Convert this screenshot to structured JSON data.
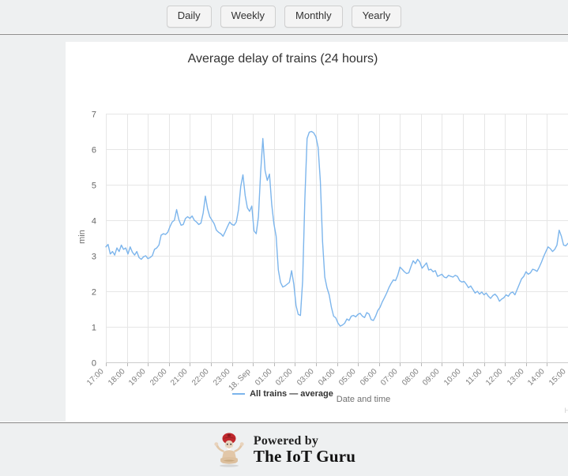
{
  "tabs": [
    {
      "label": "Daily",
      "name": "tab-daily"
    },
    {
      "label": "Weekly",
      "name": "tab-weekly"
    },
    {
      "label": "Monthly",
      "name": "tab-monthly"
    },
    {
      "label": "Yearly",
      "name": "tab-yearly"
    }
  ],
  "legend": {
    "label": "All trains — average"
  },
  "credit": "H",
  "footer": {
    "powered_by": "Powered by",
    "brand": "The IoT Guru"
  },
  "colors": {
    "series": "#7cb5ec",
    "page_background": "#eef0f1",
    "panel_background": "#ffffff",
    "grid": "#e6e6e6",
    "axis_text": "#7c7c7c",
    "title_text": "#333333"
  },
  "chart_data": {
    "type": "line",
    "title": "Average delay of trains (24 hours)",
    "xlabel": "Date and time",
    "ylabel": "min",
    "ylim": [
      0,
      7
    ],
    "yticks": [
      0,
      1,
      2,
      3,
      4,
      5,
      6,
      7
    ],
    "grid": true,
    "legend_position": "bottom",
    "xticks": [
      "17:00",
      "18:00",
      "19:00",
      "20:00",
      "21:00",
      "22:00",
      "23:00",
      "18. Sep",
      "01:00",
      "02:00",
      "03:00",
      "04:00",
      "05:00",
      "06:00",
      "07:00",
      "08:00",
      "09:00",
      "10:00",
      "11:00",
      "12:00",
      "13:00",
      "14:00",
      "15:00"
    ],
    "series": [
      {
        "name": "All trains — average",
        "unit": "min",
        "values": [
          3.25,
          3.32,
          3.05,
          3.12,
          3.02,
          3.22,
          3.12,
          3.3,
          3.18,
          3.22,
          3.05,
          3.25,
          3.1,
          3.02,
          3.12,
          2.95,
          2.9,
          2.97,
          3.0,
          2.92,
          2.95,
          3.0,
          3.18,
          3.22,
          3.3,
          3.58,
          3.62,
          3.6,
          3.66,
          3.82,
          3.95,
          4.0,
          4.3,
          4.02,
          3.86,
          3.88,
          4.05,
          4.1,
          4.05,
          4.12,
          4.0,
          3.95,
          3.88,
          3.92,
          4.2,
          4.68,
          4.32,
          4.1,
          4.0,
          3.9,
          3.72,
          3.66,
          3.62,
          3.55,
          3.68,
          3.82,
          3.95,
          3.88,
          3.86,
          3.95,
          4.3,
          4.95,
          5.28,
          4.7,
          4.35,
          4.25,
          4.4,
          3.7,
          3.62,
          4.1,
          5.35,
          6.3,
          5.4,
          5.12,
          5.3,
          4.45,
          3.9,
          3.55,
          2.6,
          2.25,
          2.12,
          2.15,
          2.2,
          2.25,
          2.58,
          2.2,
          1.6,
          1.35,
          1.32,
          2.3,
          4.6,
          6.3,
          6.48,
          6.5,
          6.46,
          6.35,
          6.05,
          5.1,
          3.4,
          2.4,
          2.1,
          1.9,
          1.55,
          1.3,
          1.25,
          1.1,
          1.02,
          1.05,
          1.1,
          1.22,
          1.18,
          1.3,
          1.32,
          1.28,
          1.35,
          1.38,
          1.3,
          1.26,
          1.4,
          1.36,
          1.2,
          1.18,
          1.3,
          1.46,
          1.55,
          1.7,
          1.82,
          1.95,
          2.1,
          2.22,
          2.32,
          2.3,
          2.45,
          2.68,
          2.62,
          2.55,
          2.5,
          2.52,
          2.7,
          2.86,
          2.78,
          2.9,
          2.82,
          2.65,
          2.72,
          2.8,
          2.6,
          2.62,
          2.55,
          2.58,
          2.42,
          2.45,
          2.48,
          2.4,
          2.38,
          2.45,
          2.42,
          2.4,
          2.45,
          2.42,
          2.3,
          2.26,
          2.28,
          2.2,
          2.1,
          2.15,
          2.05,
          1.95,
          2.0,
          1.92,
          1.98,
          1.9,
          1.95,
          1.86,
          1.8,
          1.88,
          1.92,
          1.85,
          1.72,
          1.78,
          1.82,
          1.9,
          1.86,
          1.95,
          1.98,
          1.9,
          2.05,
          2.2,
          2.35,
          2.42,
          2.55,
          2.48,
          2.52,
          2.62,
          2.6,
          2.56,
          2.68,
          2.82,
          2.98,
          3.12,
          3.25,
          3.2,
          3.12,
          3.18,
          3.3,
          3.72,
          3.55,
          3.3,
          3.28,
          3.35
        ]
      }
    ]
  }
}
